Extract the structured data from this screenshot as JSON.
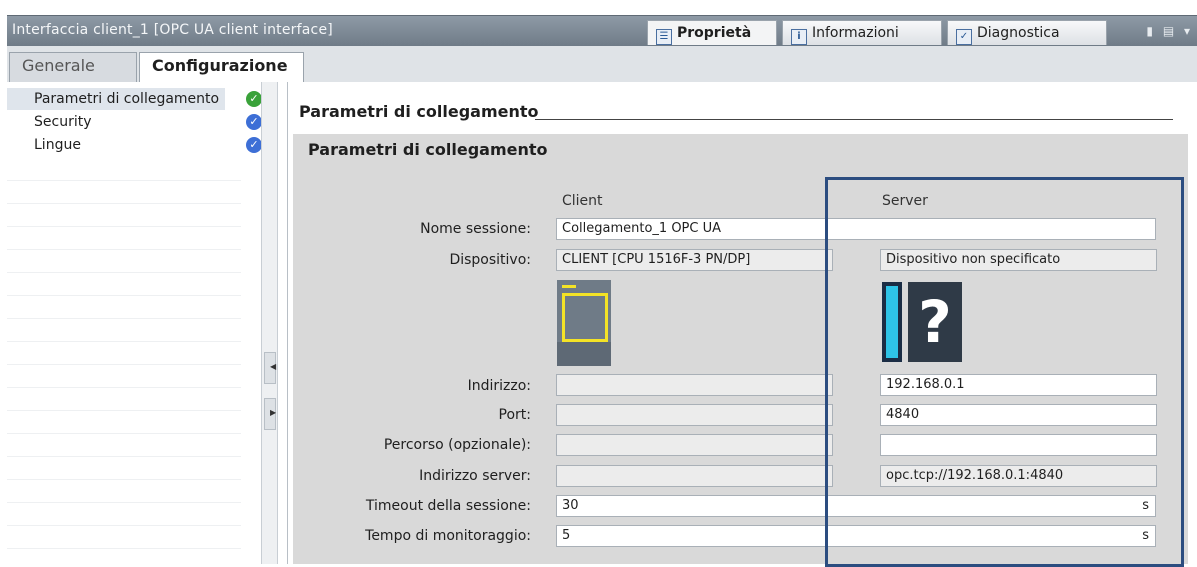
{
  "titlebar": {
    "title": "Interfaccia client_1 [OPC UA client interface]",
    "tabs": [
      {
        "label": "Proprietà",
        "icon": "properties-icon",
        "active": true
      },
      {
        "label": "Informazioni",
        "icon": "info-icon",
        "active": false
      },
      {
        "label": "Diagnostica",
        "icon": "diagnostics-icon",
        "active": false
      }
    ]
  },
  "subtabs": [
    {
      "label": "Generale",
      "active": false
    },
    {
      "label": "Configurazione",
      "active": true
    }
  ],
  "nav": {
    "items": [
      {
        "label": "Parametri di collegamento",
        "status": "ok",
        "selected": true
      },
      {
        "label": "Security",
        "status": "done",
        "selected": false
      },
      {
        "label": "Lingue",
        "status": "done",
        "selected": false
      }
    ]
  },
  "section": {
    "title": "Parametri di collegamento",
    "group_title": "Parametri di collegamento",
    "col_client": "Client",
    "col_server": "Server"
  },
  "fields": {
    "session_name": {
      "label": "Nome sessione:",
      "value": "Collegamento_1 OPC UA"
    },
    "device": {
      "label": "Dispositivo:",
      "client": "CLIENT [CPU 1516F-3 PN/DP]",
      "server": "Dispositivo non specificato"
    },
    "address": {
      "label": "Indirizzo:",
      "client": "",
      "server": "192.168.0.1"
    },
    "port": {
      "label": "Port:",
      "client": "",
      "server": "4840"
    },
    "path": {
      "label": "Percorso (opzionale):",
      "client": "",
      "server": ""
    },
    "server_address": {
      "label": "Indirizzo server:",
      "client": "",
      "server": "opc.tcp://192.168.0.1:4840"
    },
    "session_timeout": {
      "label": "Timeout della sessione:",
      "value": "30",
      "unit": "s"
    },
    "monitoring_time": {
      "label": "Tempo di monitoraggio:",
      "value": "5",
      "unit": "s"
    }
  },
  "colors": {
    "accent": "#2c4d80",
    "ok": "#3aa23a",
    "done": "#3d6fd6"
  }
}
